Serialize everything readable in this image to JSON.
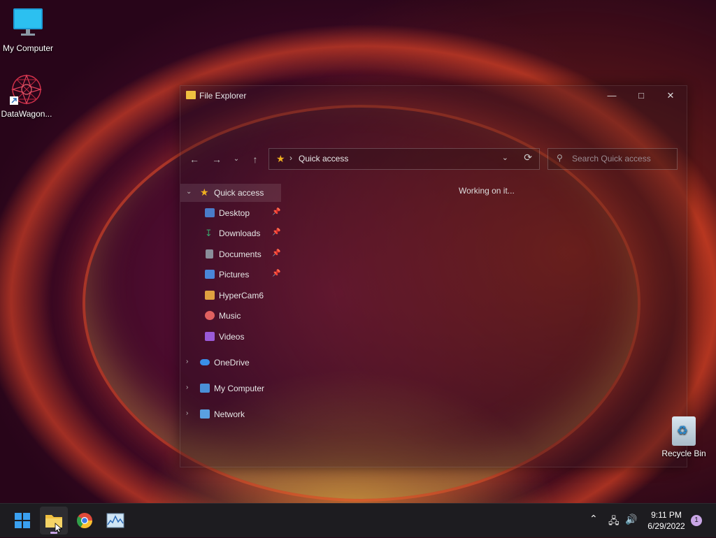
{
  "desktop": {
    "icons": [
      {
        "label": "My Computer"
      },
      {
        "label": "DataWagon..."
      }
    ],
    "recycle_bin": {
      "label": "Recycle Bin"
    }
  },
  "explorer": {
    "title": "File Explorer",
    "address": {
      "crumb": "Quick access"
    },
    "search": {
      "placeholder": "Search Quick access"
    },
    "content_status": "Working on it...",
    "nav": [
      {
        "label": "Quick access",
        "icon": "star-icon",
        "color": "#f0b020"
      },
      {
        "label": "Desktop",
        "icon": "desktop-folder-icon",
        "color": "#4a7cc9",
        "pinned": true
      },
      {
        "label": "Downloads",
        "icon": "download-icon",
        "color": "#3a9f6a",
        "pinned": true
      },
      {
        "label": "Documents",
        "icon": "documents-icon",
        "color": "#8a8f9a",
        "pinned": true
      },
      {
        "label": "Pictures",
        "icon": "pictures-icon",
        "color": "#4a86d8",
        "pinned": true
      },
      {
        "label": "HyperCam6",
        "icon": "folder-icon",
        "color": "#e0a040"
      },
      {
        "label": "Music",
        "icon": "music-icon",
        "color": "#e06060"
      },
      {
        "label": "Videos",
        "icon": "videos-icon",
        "color": "#9a5ad8"
      },
      {
        "label": "OneDrive",
        "icon": "cloud-icon",
        "color": "#3a8ee8"
      },
      {
        "label": "My Computer",
        "icon": "computer-icon",
        "color": "#4a90d8"
      },
      {
        "label": "Network",
        "icon": "network-icon",
        "color": "#5aa0e0"
      }
    ]
  },
  "taskbar": {
    "time": "9:11 PM",
    "date": "6/29/2022",
    "notifications": "1"
  }
}
